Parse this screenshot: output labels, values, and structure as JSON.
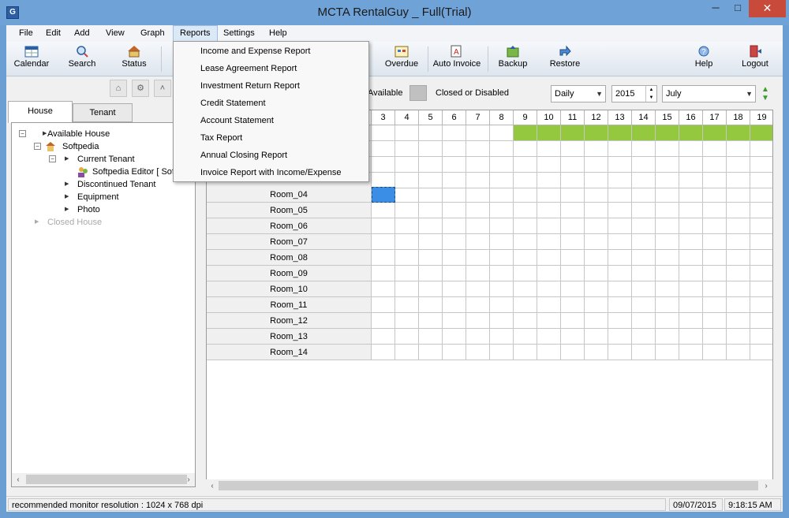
{
  "window": {
    "title": "MCTA RentalGuy _ Full(Trial)",
    "app_icon": "G",
    "min": "─",
    "max": "□",
    "close": "✕"
  },
  "menubar": [
    "File",
    "Edit",
    "Add",
    "View",
    "Graph",
    "Reports",
    "Settings",
    "Help"
  ],
  "reports_menu": [
    "Income and Expense Report",
    "Lease Agreement Report",
    "Investment Return Report",
    "Credit Statement",
    "Account Statement",
    "Tax Report",
    "Annual Closing Report",
    "Invoice Report with Income/Expense"
  ],
  "toolbar": {
    "calendar": "Calendar",
    "search": "Search",
    "status": "Status",
    "overdue": "Overdue",
    "auto_invoice": "Auto Invoice",
    "backup": "Backup",
    "restore": "Restore",
    "help": "Help",
    "logout": "Logout"
  },
  "left_tabs": {
    "house": "House",
    "tenant": "Tenant"
  },
  "tree": {
    "available_house": "Available House",
    "softpedia": "Softpedia",
    "current_tenant": "Current Tenant",
    "tenant_editor": "Softpedia Editor [ Sof",
    "discontinued": "Discontinued Tenant",
    "equipment": "Equipment",
    "photo": "Photo",
    "closed_house": "Closed House"
  },
  "legend": {
    "available": "Available",
    "closed": "Closed or Disabled"
  },
  "filters": {
    "view": "Daily",
    "year": "2015",
    "month": "July"
  },
  "grid": {
    "day_headers": [
      "3",
      "4",
      "5",
      "6",
      "7",
      "8",
      "9",
      "10",
      "11",
      "12",
      "13",
      "14",
      "15",
      "16",
      "17",
      "18",
      "19"
    ],
    "rooms": [
      "Room_04",
      "Room_05",
      "Room_06",
      "Room_07",
      "Room_08",
      "Room_09",
      "Room_10",
      "Room_11",
      "Room_12",
      "Room_13",
      "Room_14"
    ],
    "current_row_marker": "▶",
    "green_color": "#93c83f",
    "selected_color": "#3a8ee6"
  },
  "statusbar": {
    "message": "recommended monitor resolution : 1024 x 768 dpi",
    "date": "09/07/2015",
    "time": "9:18:15 AM"
  },
  "colors": {
    "titlebar": "#6fa3d8",
    "close": "#c74a3a"
  }
}
